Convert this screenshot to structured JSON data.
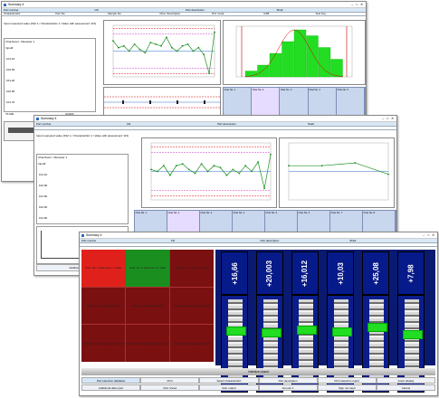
{
  "windows": [
    {
      "title": "Summary 4",
      "header": [
        "Part number",
        "CD",
        "Part description",
        "Shaft"
      ],
      "header2": [
        "Characteristic",
        "Part No.",
        "Sample No.",
        "Char. Description",
        "Characteristic",
        "Ord. Code",
        "CAB",
        "Test Key"
      ],
      "note": "Input measured value (Part 1 / Characteristic 1 / Value with assessment: W1)",
      "list_title": "Char.Descr.: Diameter 1",
      "list_label": "Input#",
      "list_values": [
        "101.10",
        "102.50",
        "101.20",
        "102.00",
        "101.70"
      ],
      "list_footer": "70.000",
      "list_footer2": "(0.000)",
      "chart_xlabel": "Value No.",
      "chart_ylabel": "x̄ - Diameter [mm]",
      "hist_xlabel": "Diameter 1 [mm], Ap. 10"
    },
    {
      "title": "Summary 4",
      "header": [
        "Part number",
        "CD",
        "Part description",
        "Shaft"
      ],
      "note": "Input measured value (Part 1 / Characteristic 1 / Value with assessment: W1)",
      "list_title": "Char.Descr.: Diameter 1",
      "list_label": "Input#",
      "list_values": [
        "101.10",
        "102.00",
        "101.50",
        "102.50",
        "101.50"
      ],
      "footer_buttons": [
        "Additional data input"
      ]
    },
    {
      "title": "Summary 4",
      "header": [
        "Part number",
        "CD",
        "Part description",
        "Shaft"
      ],
      "tiles": [
        "Char. No. 1\nDiameter 1 / Shaft",
        "Char. No. 2\nDiameter 2 / Shaft",
        "Char. No. 3\nLength 1 / Shaft",
        "Char. No. 4\nLength 2 / Shaft",
        "Char. No. 5\nRadius / Shaft",
        "Char. No. 6\nRoundness / Shaft",
        "Char. No. 7\nConcentricity / Shaft",
        "Char. No. 8\nPerpendicularity / Shaft",
        "Char. No. 9\nParallelism / Shaft"
      ],
      "gauges": [
        {
          "value": "+16,66",
          "label": "100"
        },
        {
          "value": "+20,003",
          "label": "100"
        },
        {
          "value": "+16,012",
          "label": "100"
        },
        {
          "value": "+10,03",
          "label": "100"
        },
        {
          "value": "+25,08",
          "label": "100"
        },
        {
          "value": "+7,98",
          "label": "100"
        }
      ],
      "status_bar": "Interface closed",
      "buttons_row1": [
        "Part selection database",
        "Print",
        "Select characteristic",
        "Part description",
        "Print selection report",
        "Insert display"
      ],
      "buttons_row2": [
        "Additional data input",
        "Add. Views",
        "Add. output",
        "Amount 1",
        "Sign not used",
        "Cancel"
      ]
    }
  ],
  "chart1": {
    "type": "line",
    "title": "",
    "xlabel": "Value No.",
    "ylabel": "x̄ - Diameter [mm]",
    "x": [
      1,
      2,
      3,
      4,
      5,
      6,
      7,
      8,
      9,
      10,
      11,
      12,
      13,
      14,
      15,
      16,
      17,
      18,
      19,
      20
    ],
    "values": [
      102.1,
      101.7,
      101.8,
      101.5,
      101.9,
      101.6,
      101.4,
      102.0,
      101.9,
      101.8,
      102.3,
      101.7,
      101.5,
      101.8,
      101.9,
      101.5,
      101.7,
      101.3,
      100.2,
      102.6
    ],
    "ylim": [
      100.0,
      103.0
    ],
    "limits": {
      "usl": 102.8,
      "ucl": 102.5,
      "lcl": 100.5,
      "lsl": 100.2
    }
  },
  "hist1": {
    "type": "bar",
    "values": [
      1,
      2,
      4,
      6,
      8,
      7,
      5,
      3
    ],
    "colors": {
      "bar": "#22dd22",
      "limits": "#cc0000"
    }
  },
  "chart2": {
    "type": "line",
    "values": [
      101.6,
      101.5,
      101.8,
      101.3,
      101.8,
      101.9,
      101.6,
      101.4,
      101.9,
      101.5,
      101.8,
      101.7,
      101.3,
      101.6,
      101.4,
      101.8,
      101.5,
      102.0,
      100.6,
      102.4
    ],
    "ylim": [
      100.0,
      103.0
    ]
  },
  "chart3": {
    "type": "line",
    "values": [
      104.2,
      104.2,
      104.3,
      103.9
    ],
    "ylim": [
      103.0,
      105.0
    ]
  },
  "colors": {
    "accent": "#2a6cc7",
    "red_tile": "#e0211b",
    "green_tile": "#1a8f1f",
    "dark_red_tile": "#7a1010",
    "gauge_blue": "#071a8a",
    "gauge_target": "#22dd22"
  }
}
